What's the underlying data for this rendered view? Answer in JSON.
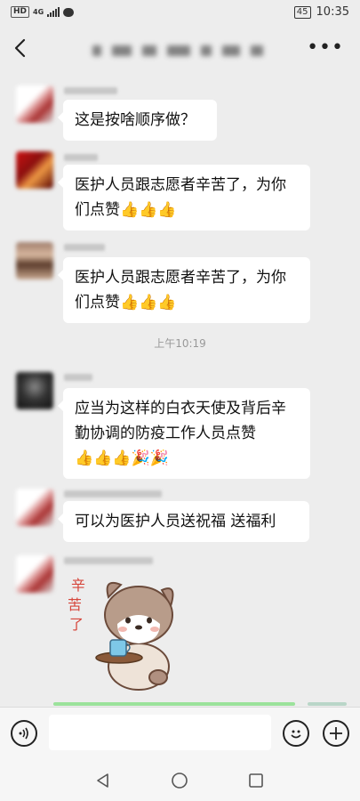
{
  "status_bar": {
    "hd": "HD",
    "network": "4G",
    "battery": "45",
    "time": "10:35"
  },
  "header": {
    "back_icon": "chevron-left-icon",
    "title": "",
    "more_icon": "more-dots-icon"
  },
  "messages": [
    {
      "text": "这是按啥顺序做？"
    },
    {
      "text": "医护人员跟志愿者辛苦了，为你们点赞",
      "emojis": "👍👍👍"
    },
    {
      "text": "医护人员跟志愿者辛苦了，为你们点赞",
      "emojis": "👍👍👍"
    },
    {
      "text": "应当为这样的白衣天使及背后辛勤协调的防疫工作人员点赞",
      "emojis": "👍👍👍🎉🎉"
    },
    {
      "text": "可以为医护人员送祝福 送福利"
    }
  ],
  "timestamp": "上午10:19",
  "sticker": {
    "text": "辛苦了"
  },
  "input_bar": {
    "voice_icon": "voice-icon",
    "emoji_icon": "emoji-icon",
    "plus_icon": "plus-icon",
    "placeholder": ""
  },
  "system_nav": {
    "back_icon": "triangle-back-icon",
    "home_icon": "circle-home-icon",
    "recents_icon": "square-recents-icon"
  }
}
